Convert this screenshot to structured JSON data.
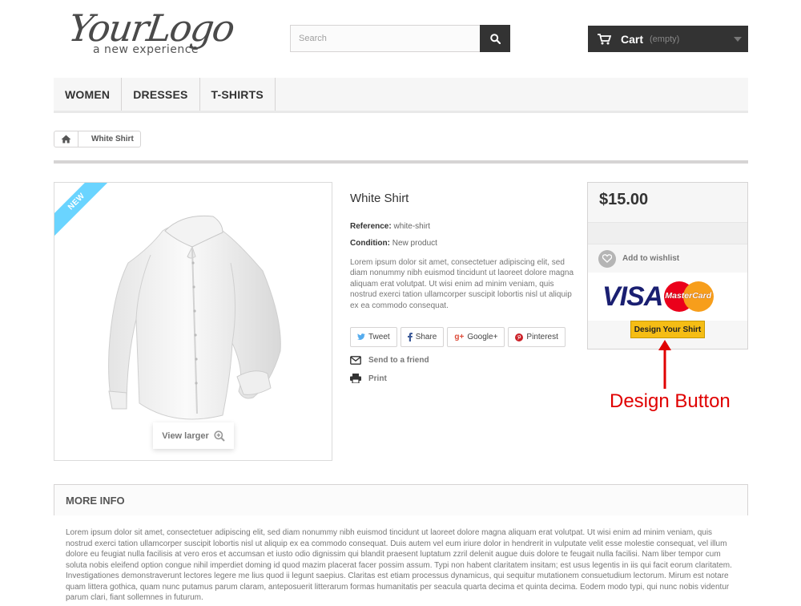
{
  "header": {
    "logo": {
      "main": "YourLogo",
      "tagline": "a new experience"
    },
    "search": {
      "placeholder": "Search",
      "button_icon": "search-icon"
    },
    "cart": {
      "label": "Cart",
      "status": "(empty)",
      "icon": "cart-icon"
    }
  },
  "nav": {
    "items": [
      "WOMEN",
      "DRESSES",
      "T-SHIRTS"
    ]
  },
  "breadcrumb": {
    "home_icon": "home-icon",
    "current": "White Shirt"
  },
  "product": {
    "badge": "NEW",
    "view_larger": "View larger",
    "title": "White Shirt",
    "reference_label": "Reference:",
    "reference_value": "white-shirt",
    "condition_label": "Condition:",
    "condition_value": "New product",
    "description": "Lorem ipsum dolor sit amet, consectetuer adipiscing elit, sed diam nonummy nibh euismod tincidunt ut laoreet dolore magna aliquam erat volutpat. Ut wisi enim ad minim veniam, quis nostrud exerci tation ullamcorper suscipit lobortis nisl ut aliquip ex ea commodo consequat.",
    "social": [
      {
        "label": "Tweet",
        "icon": "twitter-icon",
        "color": "#55acee"
      },
      {
        "label": "Share",
        "icon": "facebook-icon",
        "color": "#3b5998"
      },
      {
        "label": "Google+",
        "icon": "google-plus-icon",
        "color": "#dd4b39"
      },
      {
        "label": "Pinterest",
        "icon": "pinterest-icon",
        "color": "#cb2027"
      }
    ],
    "send_to_friend": "Send to a friend",
    "print": "Print"
  },
  "buy_box": {
    "price": "$15.00",
    "wishlist": "Add to wishlist",
    "card_visa": "VISA",
    "card_mastercard": "MasterCard",
    "design_button": "Design Your Shirt"
  },
  "annotation": {
    "label": "Design Button",
    "color": "#e00000"
  },
  "more_info": {
    "title": "MORE INFO",
    "text": "Lorem ipsum dolor sit amet, consectetuer adipiscing elit, sed diam nonummy nibh euismod tincidunt ut laoreet dolore magna aliquam erat volutpat. Ut wisi enim ad minim veniam, quis nostrud exerci tation ullamcorper suscipit lobortis nisl ut aliquip ex ea commodo consequat. Duis autem vel eum iriure dolor in hendrerit in vulputate velit esse molestie consequat, vel illum dolore eu feugiat nulla facilisis at vero eros et accumsan et iusto odio dignissim qui blandit praesent luptatum zzril delenit augue duis dolore te feugait nulla facilisi. Nam liber tempor cum soluta nobis eleifend option congue nihil imperdiet doming id quod mazim placerat facer possim assum. Typi non habent claritatem insitam; est usus legentis in iis qui facit eorum claritatem. Investigationes demonstraverunt lectores legere me lius quod ii legunt saepius. Claritas est etiam processus dynamicus, qui sequitur mutationem consuetudium lectorum. Mirum est notare quam littera gothica, quam nunc putamus parum claram, anteposuerit litterarum formas humanitatis per seacula quarta decima et quinta decima. Eodem modo typi, qui nunc nobis videntur parum clari, fiant sollemnes in futurum."
  }
}
